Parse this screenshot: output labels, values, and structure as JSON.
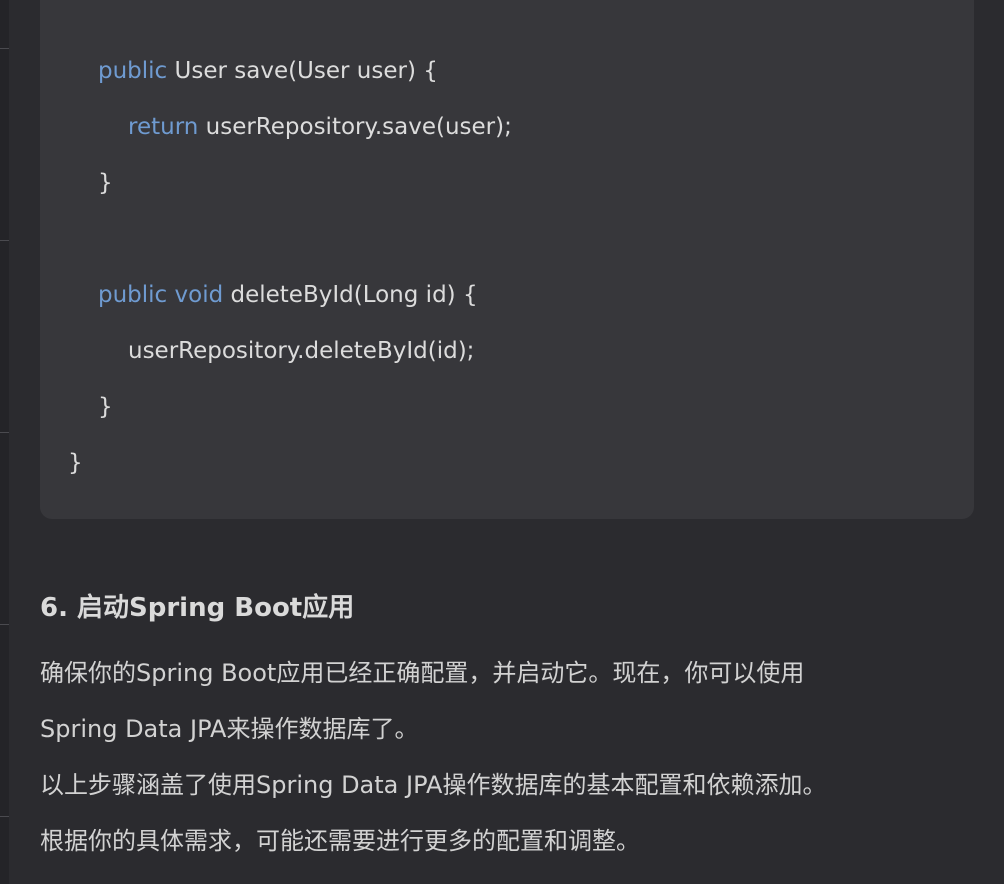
{
  "code": {
    "lines": [
      {
        "kw": "public",
        "rest": " User save(User user) {"
      },
      {
        "kw": "return",
        "rest": " userRepository.save(user);"
      },
      {
        "kw": "",
        "rest": "}"
      },
      {
        "kw": "public void",
        "rest": " deleteById(Long id) {"
      },
      {
        "kw": "",
        "rest": "userRepository.deleteById(id);"
      },
      {
        "kw": "",
        "rest": "}"
      },
      {
        "kw": "",
        "rest": "}"
      }
    ]
  },
  "section": {
    "heading": "6. 启动Spring Boot应用",
    "paragraphs": [
      "确保你的Spring Boot应用已经正确配置，并启动它。现在，你可以使用",
      "Spring Data JPA来操作数据库了。",
      "以上步骤涵盖了使用Spring Data JPA操作数据库的基本配置和依赖添加。",
      "根据你的具体需求，可能还需要进行更多的配置和调整。"
    ]
  }
}
